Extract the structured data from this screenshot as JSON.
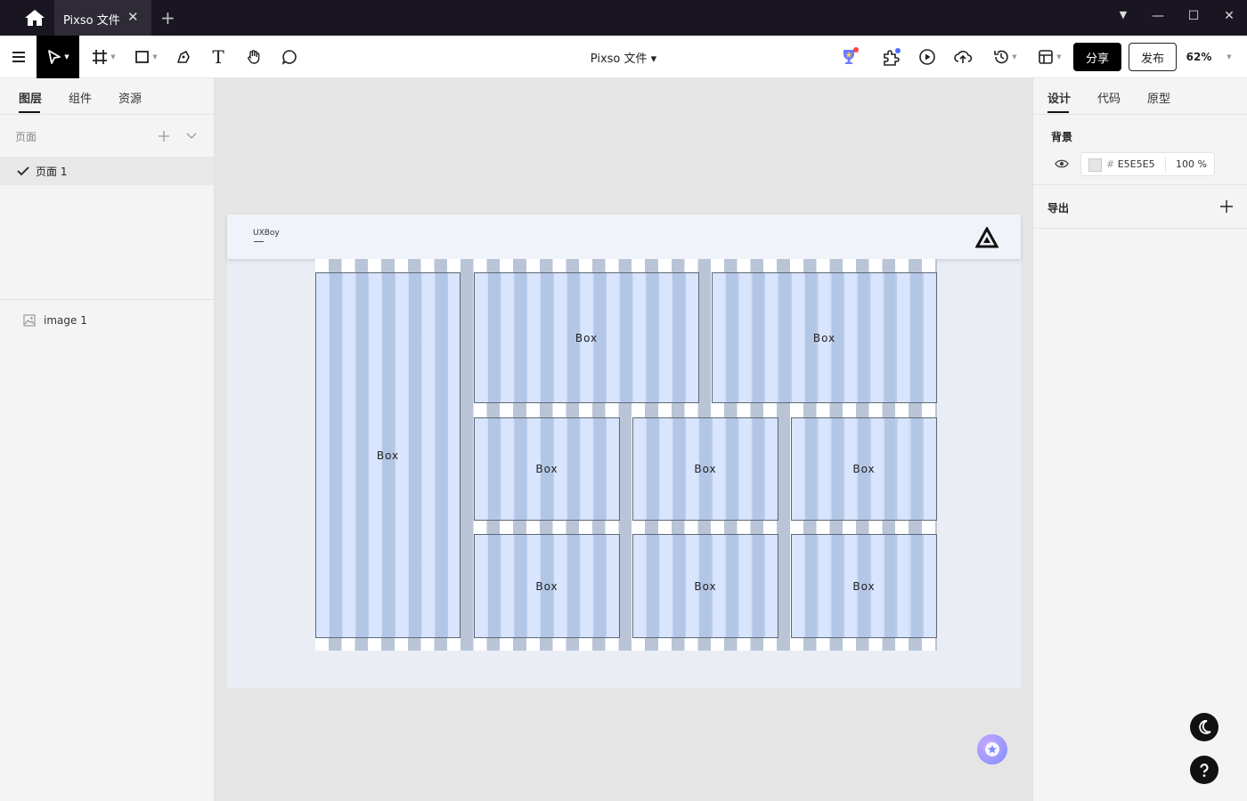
{
  "titlebar": {
    "tab_title": "Pixso 文件",
    "tab_close": "✕",
    "new_tab": "+",
    "minimize": "—",
    "maximize": "☐",
    "close": "✕",
    "dropdown": "▼"
  },
  "toolbar": {
    "doc_name": "Pixso 文件 ▾",
    "share_label": "分享",
    "publish_label": "发布",
    "zoom": "62%",
    "text_tool": "T"
  },
  "left_panel": {
    "tabs": [
      "图层",
      "组件",
      "资源"
    ],
    "pages_label": "页面",
    "page_item": "页面 1",
    "layer_item": "image 1"
  },
  "right_panel": {
    "tabs": [
      "设计",
      "代码",
      "原型"
    ],
    "background_title": "背景",
    "bg_hex": "E5E5E5",
    "bg_hash": "#",
    "bg_opacity": "100 %",
    "export_title": "导出"
  },
  "canvas": {
    "brand": "UXBoy",
    "boxes": [
      "Box",
      "Box",
      "Box",
      "Box",
      "Box",
      "Box",
      "Box",
      "Box",
      "Box"
    ]
  },
  "colors": {
    "titlebar": "#1a1621",
    "accent": "#000000",
    "canvas_bg": "#e5e5e5"
  }
}
